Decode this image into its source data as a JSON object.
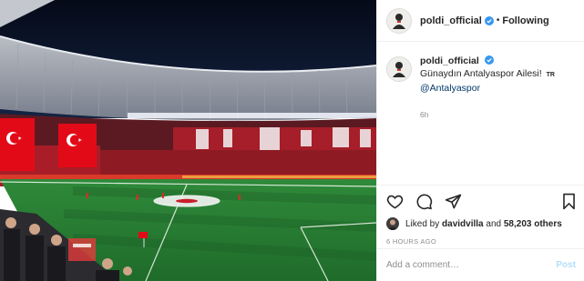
{
  "post": {
    "image_alt": "Stadium photo",
    "author": {
      "username": "poldi_official",
      "verified": true,
      "follow_state": "Following",
      "separator": "•"
    },
    "caption": {
      "username": "poldi_official",
      "text": "Günaydın Antalyaspor Ailesi!",
      "flag_text": "TR",
      "mention": "@Antalyaspor",
      "time": "6h"
    },
    "actions": {
      "icons": [
        "heart-icon",
        "comment-icon",
        "share-icon",
        "bookmark-icon"
      ]
    },
    "likes": {
      "prefix": "Liked by",
      "first_user": "davidvilla",
      "joiner": "and",
      "others": "58,203 others"
    },
    "timeago": "6 HOURS AGO",
    "comment": {
      "placeholder": "Add a comment…",
      "post_label": "Post"
    },
    "colors": {
      "verified_blue": "#3897f0",
      "mention_blue": "#00376b",
      "post_button_disabled": "#b2dffc",
      "turkish_red": "#e30a17"
    }
  }
}
